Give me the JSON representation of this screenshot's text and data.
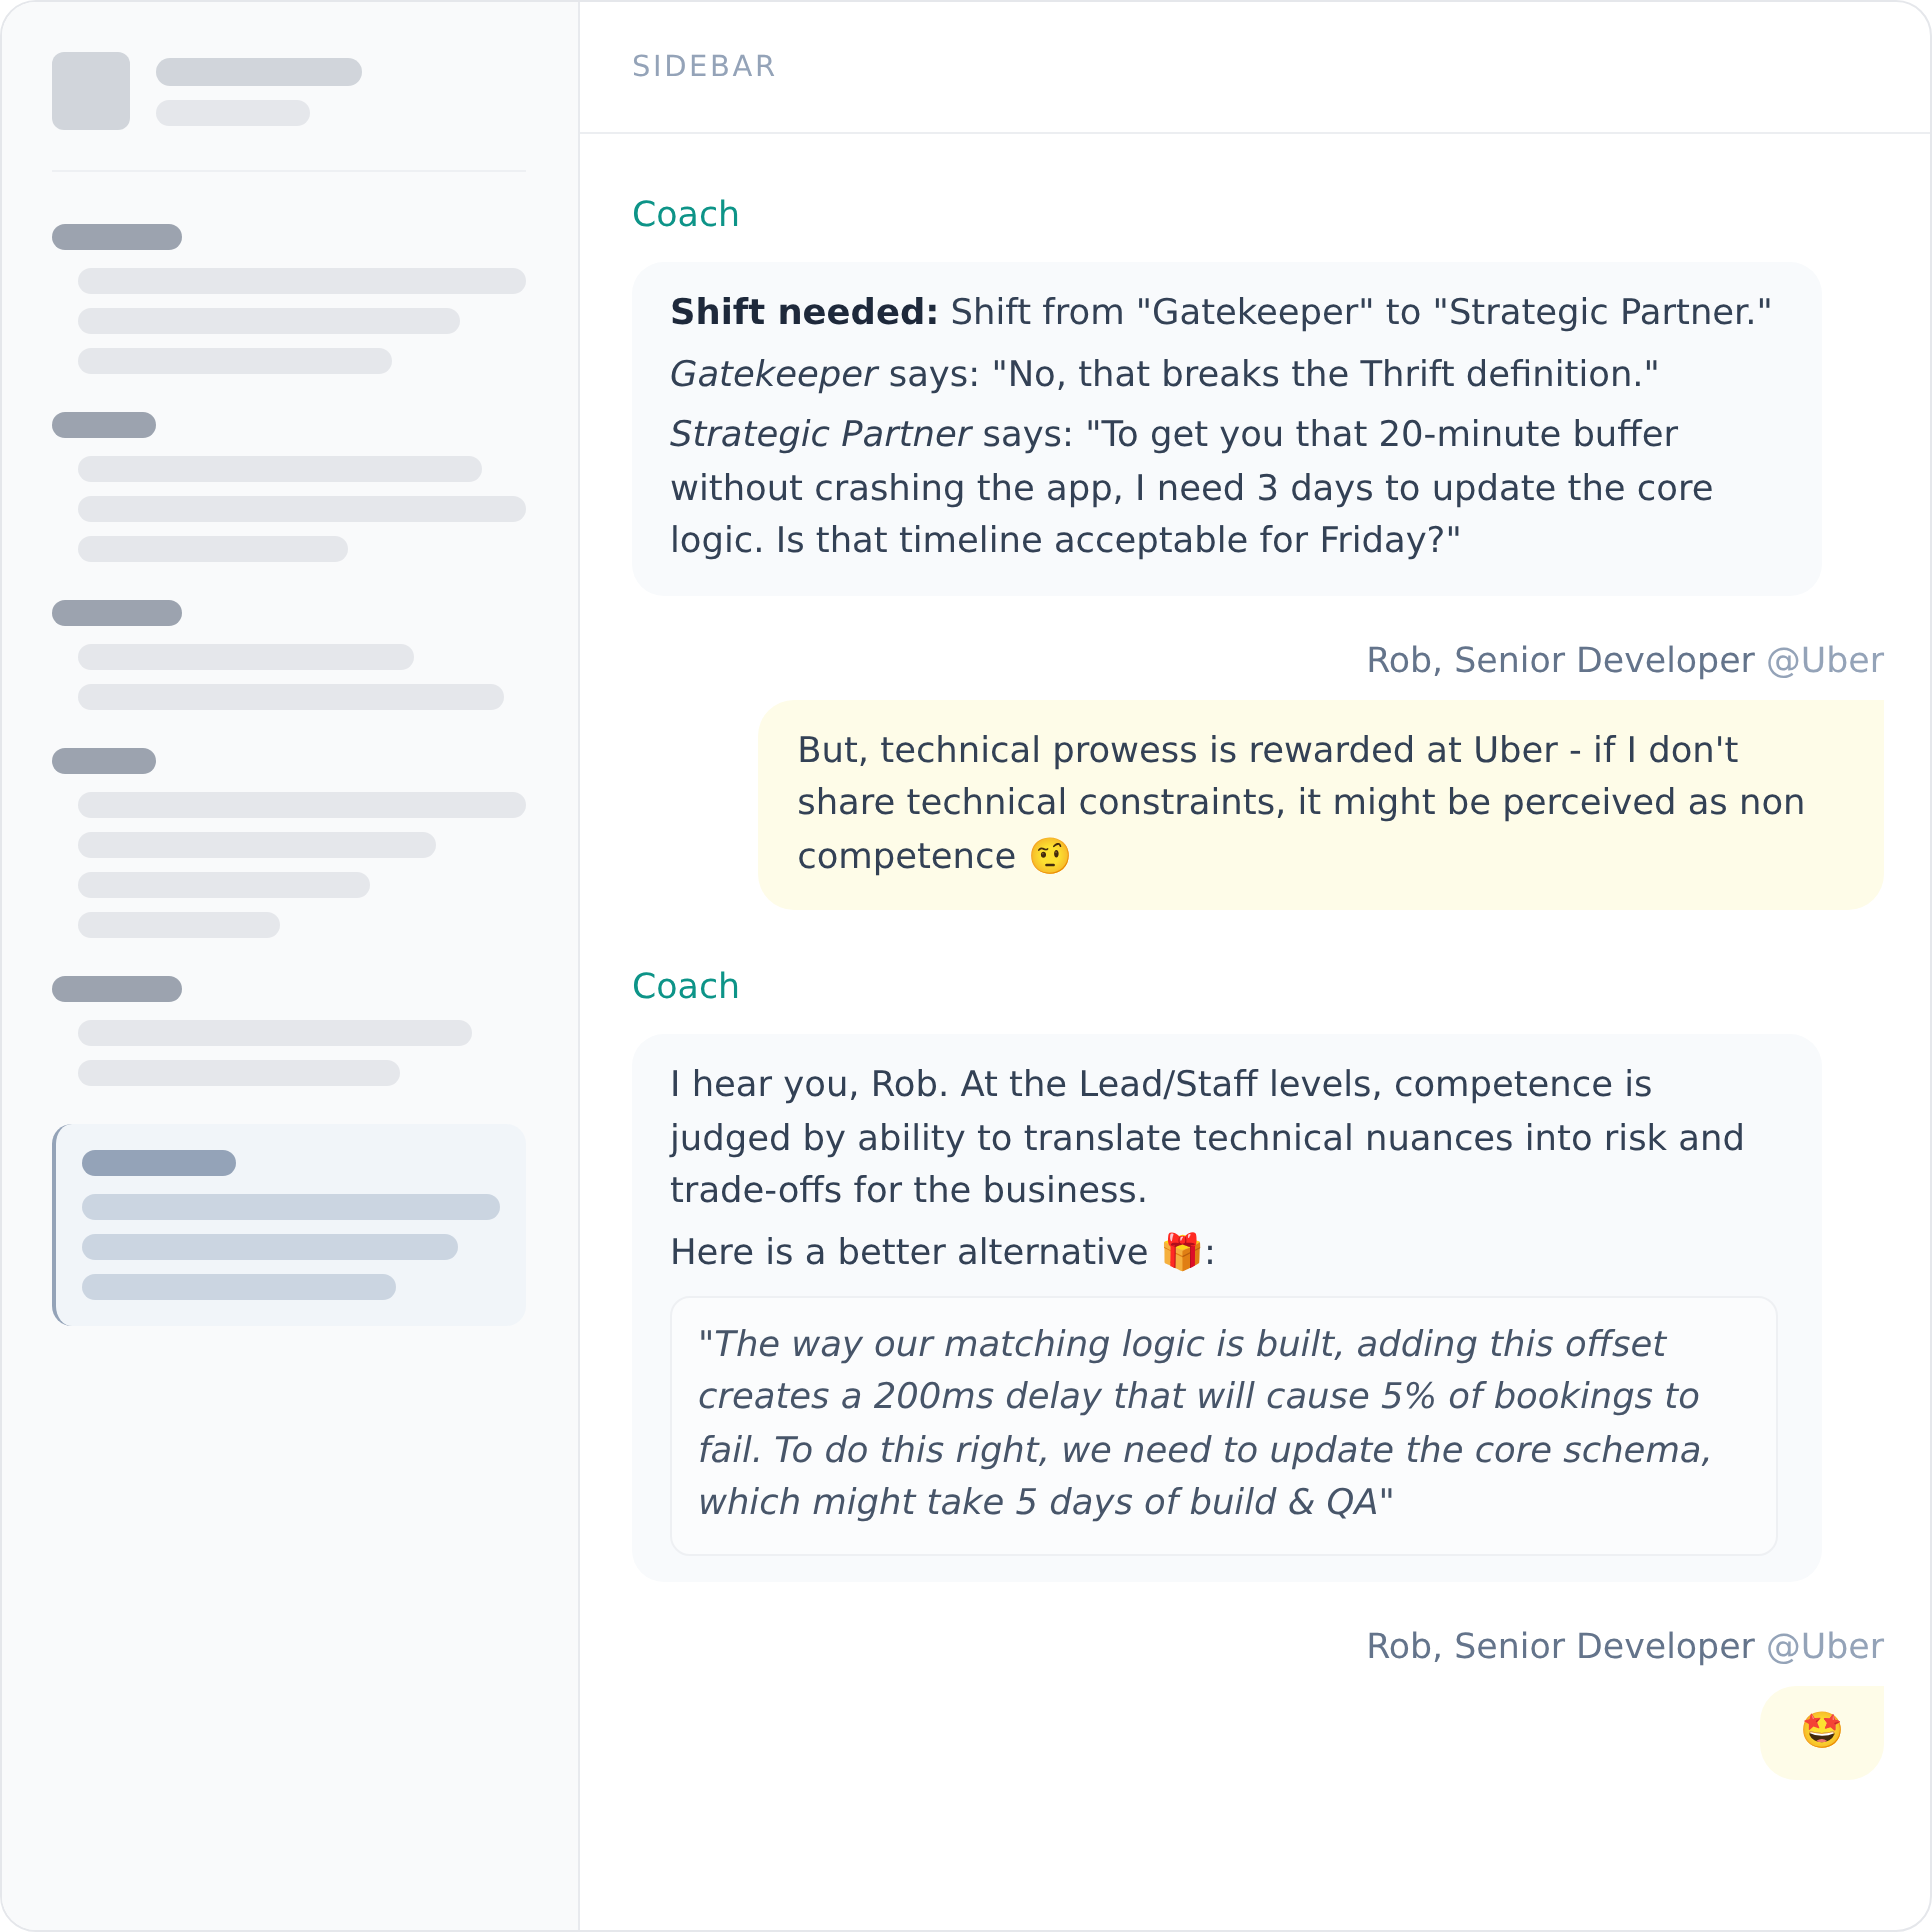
{
  "header": {
    "title": "SIDEBAR"
  },
  "sidebar": {
    "groups": [
      {
        "selected": false
      },
      {
        "selected": false
      },
      {
        "selected": false
      },
      {
        "selected": false
      },
      {
        "selected": false
      },
      {
        "selected": true
      }
    ]
  },
  "messages": [
    {
      "kind": "coach",
      "author": "Coach",
      "paragraphs": [
        "**Shift needed:** Shift from \"Gatekeeper\" to \"Strategic Partner.\"",
        "*Gatekeeper* says: \"No, that breaks the Thrift definition.\"",
        "*Strategic Partner* says: \"To get you that 20-minute buffer without crashing the app, I need 3 days to update the core logic. Is that timeline acceptable for Friday?\""
      ]
    },
    {
      "kind": "user",
      "author": "Rob, Senior Developer",
      "handle": "@Uber",
      "paragraphs": [
        "But, technical prowess is rewarded at Uber - if I don't share technical constraints, it might be perceived as non competence 🤨"
      ]
    },
    {
      "kind": "coach",
      "author": "Coach",
      "paragraphs": [
        "I hear you, Rob. At the Lead/Staff levels, competence is judged by ability to translate technical nuances into risk and trade-offs for the business.",
        "Here is a better alternative 🎁:"
      ],
      "quote": "\"The way our matching logic is built, adding this offset creates a 200ms delay that will cause 5% of bookings to fail. To do this right, we need to update the core schema, which might take 5 days of build & QA\""
    },
    {
      "kind": "user",
      "author": "Rob, Senior Developer",
      "handle": "@Uber",
      "paragraphs": [
        "🤩"
      ]
    }
  ]
}
